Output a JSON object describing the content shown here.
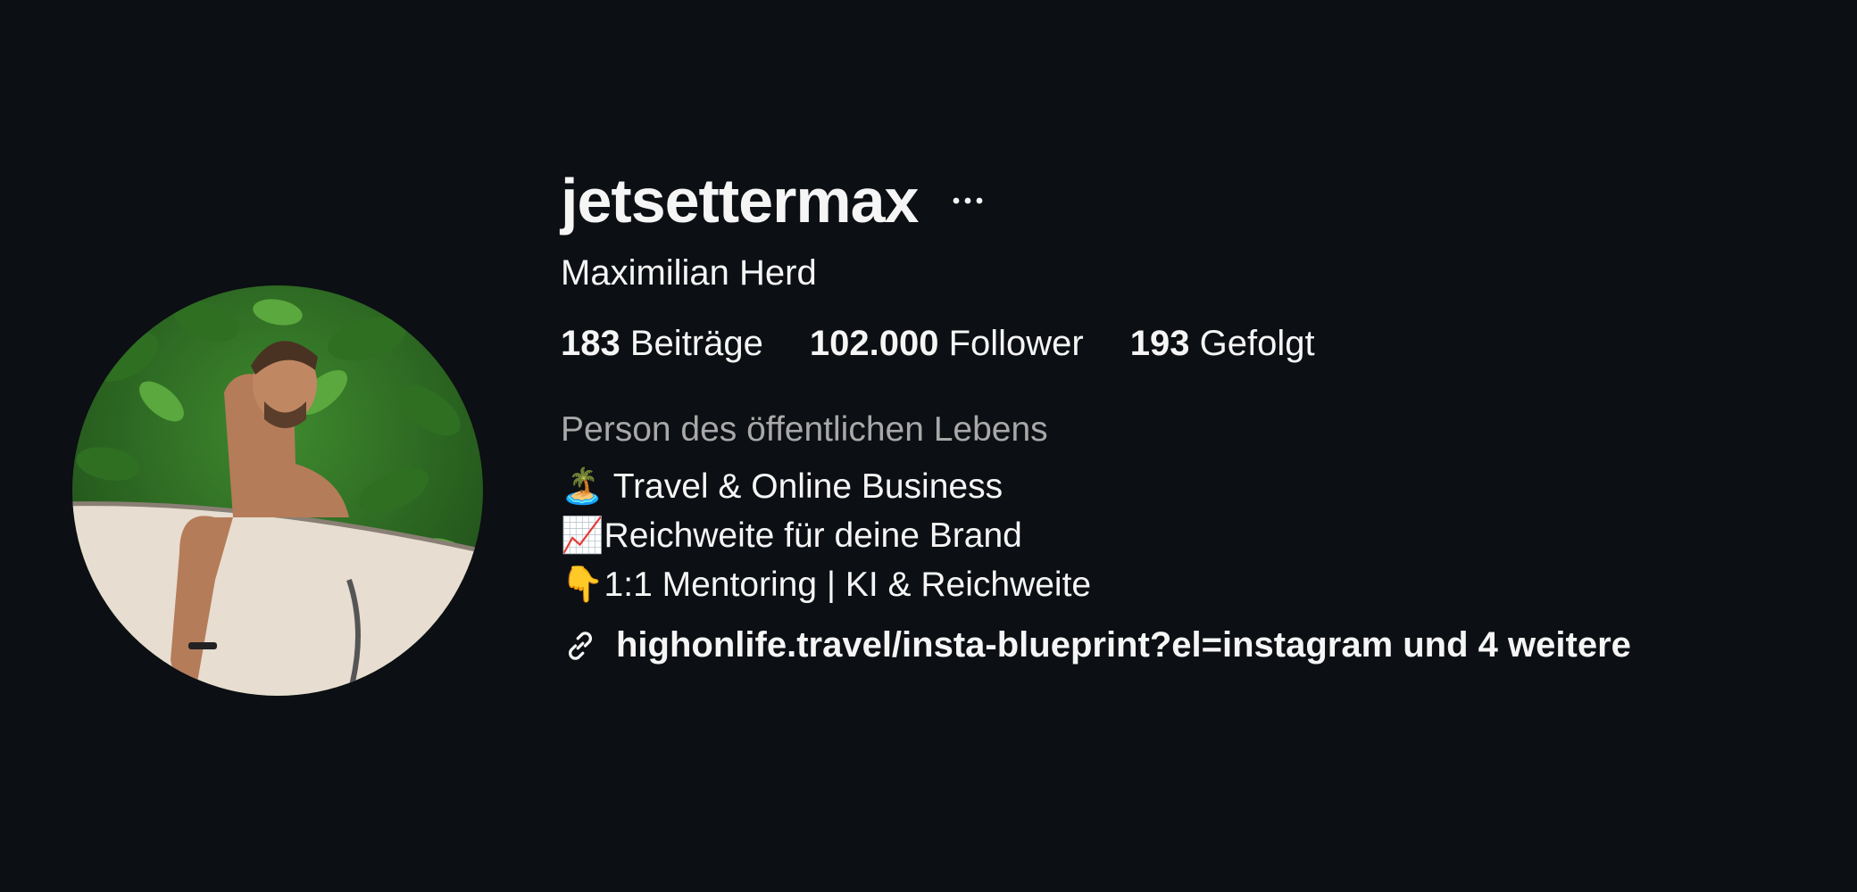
{
  "profile": {
    "username": "jetsettermax",
    "full_name": "Maximilian Herd",
    "more_icon": "ellipsis-icon",
    "stats": [
      {
        "value": "183",
        "label": "Beiträge"
      },
      {
        "value": "102.000",
        "label": "Follower"
      },
      {
        "value": "193",
        "label": "Gefolgt"
      }
    ],
    "category": "Person des öffentlichen Lebens",
    "bio_lines": [
      "🏝️ Travel & Online Business",
      "📈Reichweite für deine Brand",
      "👇1:1 Mentoring | KI & Reichweite"
    ],
    "link": {
      "icon": "link-icon",
      "text": "highonlife.travel/insta-blueprint?el=instagram und 4 weitere"
    }
  },
  "colors": {
    "background": "#0c0f13",
    "text_primary": "#f5f5f5",
    "text_secondary": "#a8a8a8"
  }
}
